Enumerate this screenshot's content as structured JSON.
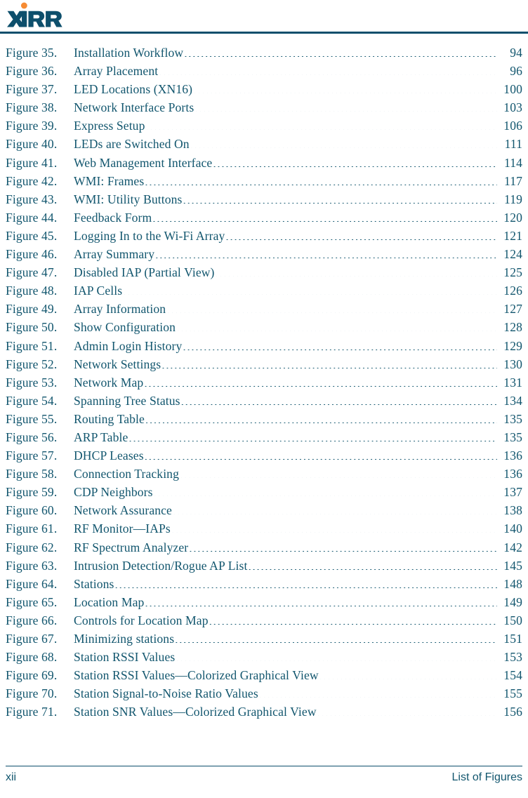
{
  "header": {
    "logo_text": "XIRRUS",
    "logo_trademark": "®",
    "logo_dot_color": "#F68B33",
    "logo_color": "#0d4f6c",
    "rule_color": "#0d4f6c"
  },
  "theme": {
    "text_color": "#12566e",
    "accent_orange": "#F68B33",
    "rule_color": "#0d4f6c",
    "background": "#ffffff"
  },
  "figures": [
    {
      "label": "Figure 35.",
      "title": "Installation Workflow",
      "page": "94"
    },
    {
      "label": "Figure 36.",
      "title": "Array Placement",
      "page": "96"
    },
    {
      "label": "Figure 37.",
      "title": "LED Locations (XN16)",
      "page": "100"
    },
    {
      "label": "Figure 38.",
      "title": "Network Interface Ports",
      "page": "103"
    },
    {
      "label": "Figure 39.",
      "title": "Express Setup",
      "page": "106"
    },
    {
      "label": "Figure 40.",
      "title": "LEDs are Switched On",
      "page": "111"
    },
    {
      "label": "Figure 41.",
      "title": "Web Management Interface",
      "page": "114"
    },
    {
      "label": "Figure 42.",
      "title": "WMI: Frames",
      "page": "117"
    },
    {
      "label": "Figure 43.",
      "title": "WMI: Utility Buttons",
      "page": "119"
    },
    {
      "label": "Figure 44.",
      "title": "Feedback Form",
      "page": "120"
    },
    {
      "label": "Figure 45.",
      "title": "Logging In to the Wi-Fi Array",
      "page": "121"
    },
    {
      "label": "Figure 46.",
      "title": "Array Summary",
      "page": "124"
    },
    {
      "label": "Figure 47.",
      "title": "Disabled IAP (Partial View)",
      "page": "125"
    },
    {
      "label": "Figure 48.",
      "title": "IAP Cells",
      "page": "126"
    },
    {
      "label": "Figure 49.",
      "title": "Array Information",
      "page": "127"
    },
    {
      "label": "Figure 50.",
      "title": "Show Configuration",
      "page": "128"
    },
    {
      "label": "Figure 51.",
      "title": "Admin Login History",
      "page": "129"
    },
    {
      "label": "Figure 52.",
      "title": "Network Settings",
      "page": "130"
    },
    {
      "label": "Figure 53.",
      "title": "Network Map",
      "page": "131"
    },
    {
      "label": "Figure 54.",
      "title": "Spanning Tree Status",
      "page": "134"
    },
    {
      "label": "Figure 55.",
      "title": "Routing Table",
      "page": "135"
    },
    {
      "label": "Figure 56.",
      "title": "ARP Table",
      "page": "135"
    },
    {
      "label": "Figure 57.",
      "title": "DHCP Leases",
      "page": "136"
    },
    {
      "label": "Figure 58.",
      "title": "Connection Tracking",
      "page": "136"
    },
    {
      "label": "Figure 59.",
      "title": "CDP Neighbors",
      "page": "137"
    },
    {
      "label": "Figure 60.",
      "title": "Network Assurance",
      "page": "138"
    },
    {
      "label": "Figure 61.",
      "title": "RF Monitor—IAPs",
      "page": "140"
    },
    {
      "label": "Figure 62.",
      "title": "RF Spectrum Analyzer",
      "page": "142"
    },
    {
      "label": "Figure 63.",
      "title": "Intrusion Detection/Rogue AP List",
      "page": "145"
    },
    {
      "label": "Figure 64.",
      "title": "Stations",
      "page": "148"
    },
    {
      "label": "Figure 65.",
      "title": "Location Map",
      "page": "149"
    },
    {
      "label": "Figure 66.",
      "title": "Controls for Location Map",
      "page": "150"
    },
    {
      "label": "Figure 67.",
      "title": "Minimizing stations",
      "page": "151"
    },
    {
      "label": "Figure 68.",
      "title": "Station RSSI Values",
      "page": "153"
    },
    {
      "label": "Figure 69.",
      "title": "Station RSSI Values—Colorized Graphical View",
      "page": "154"
    },
    {
      "label": "Figure 70.",
      "title": "Station Signal-to-Noise Ratio Values",
      "page": "155"
    },
    {
      "label": "Figure 71.",
      "title": "Station SNR Values—Colorized Graphical View",
      "page": "156"
    }
  ],
  "footer": {
    "page_number": "xii",
    "section_title": "List of Figures"
  }
}
